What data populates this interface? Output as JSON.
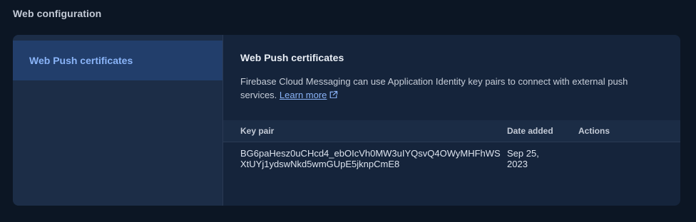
{
  "section": {
    "title": "Web configuration"
  },
  "sidebar": {
    "items": [
      {
        "label": "Web Push certificates"
      }
    ]
  },
  "main": {
    "title": "Web Push certificates",
    "description": "Firebase Cloud Messaging can use Application Identity key pairs to connect with external push services.",
    "learn_more": "Learn more",
    "learn_more_icon": "external-link-icon"
  },
  "table": {
    "headers": {
      "key_pair": "Key pair",
      "date_added": "Date added",
      "actions": "Actions"
    },
    "rows": [
      {
        "key_line1": "BG6paHesz0uCHcd4_ebOIcVh0MW3uIYQsvQ4OWyMHFhWS",
        "key_line2": "XtUYj1ydswNkd5wmGUpE5jknpCmE8",
        "date_line1": "Sep 25,",
        "date_line2": "2023"
      }
    ]
  },
  "colors": {
    "background": "#0c1624",
    "card": "#15243b",
    "sidebar": "#1c2d47",
    "selected_item": "#223e6b",
    "accent": "#8ab4f8"
  }
}
